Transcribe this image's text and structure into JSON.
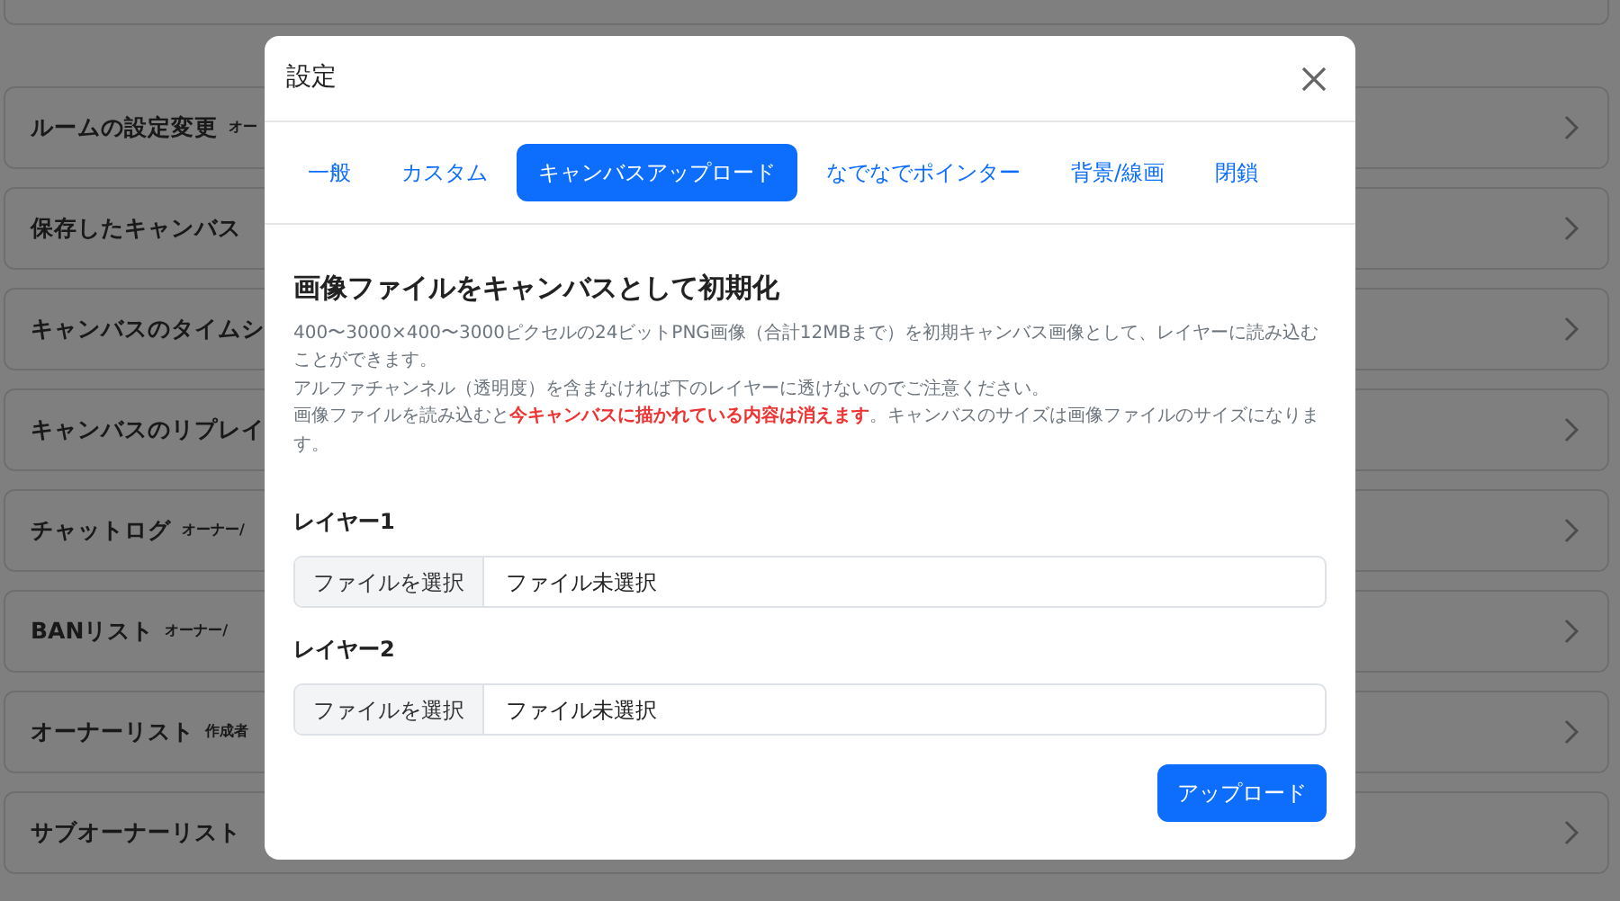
{
  "background_list": [
    {
      "title": "ルームの設定変更",
      "note": "オー"
    },
    {
      "title": "保存したキャンバス"
    },
    {
      "title": "キャンバスのタイムシ"
    },
    {
      "title": "キャンバスのリプレイ"
    },
    {
      "title": "チャットログ",
      "note": "オーナー/"
    },
    {
      "title": "BANリスト",
      "note": "オーナー/"
    },
    {
      "title": "オーナーリスト",
      "note": "作成者"
    },
    {
      "title": "サブオーナーリスト"
    }
  ],
  "modal": {
    "title": "設定",
    "tabs": [
      {
        "label": "一般",
        "selected": false
      },
      {
        "label": "カスタム",
        "selected": false
      },
      {
        "label": "キャンバスアップロード",
        "selected": true
      },
      {
        "label": "なでなでポインター",
        "selected": false
      },
      {
        "label": "背景/線画",
        "selected": false
      },
      {
        "label": "閉鎖",
        "selected": false
      }
    ],
    "heading": "画像ファイルをキャンバスとして初期化",
    "description": [
      "400〜3000×400〜3000ピクセルの24ビットPNG画像（合計12MBまで）を初期キャンバス画像として、レイヤーに読み込むことができます。",
      "アルファチャンネル（透明度）を含まなければ下のレイヤーに透けないのでご注意ください。",
      "画像ファイルを読み込むと**今キャンバスに描かれている内容は消えます**。キャンバスのサイズは画像ファイルのサイズになります。"
    ],
    "layers": [
      {
        "label": "レイヤー1",
        "button": "ファイルを選択",
        "value": "ファイル未選択"
      },
      {
        "label": "レイヤー2",
        "button": "ファイルを選択",
        "value": "ファイル未選択"
      }
    ],
    "submit": "アップロード"
  }
}
